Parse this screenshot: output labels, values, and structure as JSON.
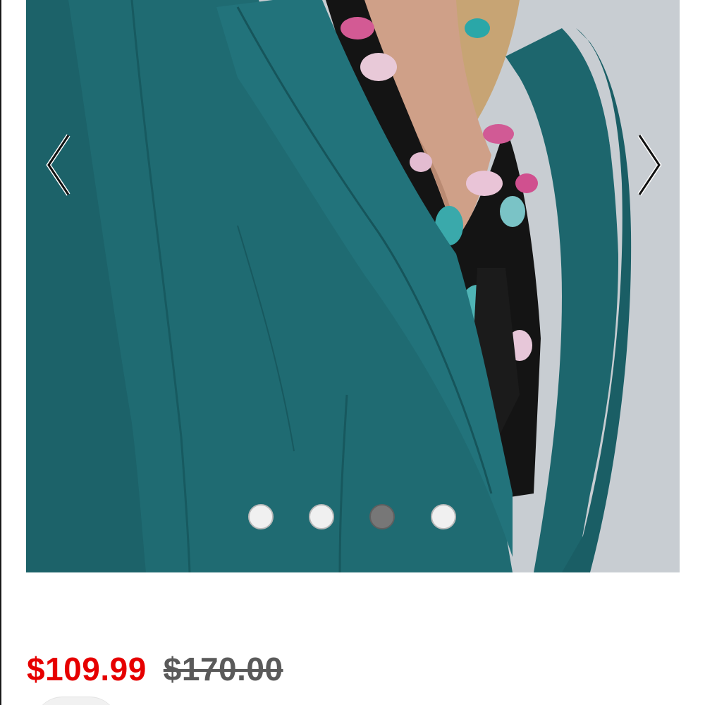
{
  "product": {
    "image_alt": "teal-blazer-photo",
    "sale_price": "$109.99",
    "original_price": "$170.00"
  },
  "carousel": {
    "prev_icon": "chevron-left-icon",
    "next_icon": "chevron-right-icon",
    "slide_count": 4,
    "active_index": 3
  },
  "colors": {
    "sale_price": "#e60000",
    "original_price": "#5a5a5a",
    "blazer_teal": "#1f6b72",
    "dot_inactive": "#f0f0f0",
    "dot_active": "#777777"
  }
}
